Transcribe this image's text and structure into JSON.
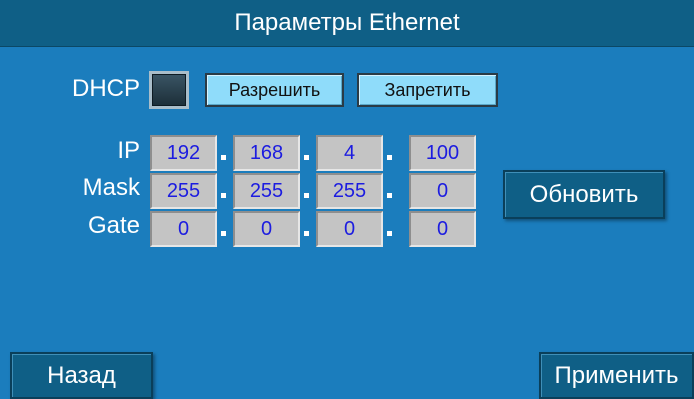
{
  "title": "Параметры Ethernet",
  "dhcp": {
    "label": "DHCP",
    "enable_label": "Разрешить",
    "disable_label": "Запретить"
  },
  "network": {
    "ip_label": "IP",
    "mask_label": "Mask",
    "gate_label": "Gate",
    "ip": [
      "192",
      "168",
      "4",
      "100"
    ],
    "mask": [
      "255",
      "255",
      "255",
      "0"
    ],
    "gate": [
      "0",
      "0",
      "0",
      "0"
    ]
  },
  "buttons": {
    "refresh": "Обновить",
    "back": "Назад",
    "apply": "Применить"
  },
  "colors": {
    "background": "#1b7dbd",
    "titlebar": "#0f5f86",
    "field_text": "#1c1ce0",
    "light_button": "#8fdcfa"
  }
}
